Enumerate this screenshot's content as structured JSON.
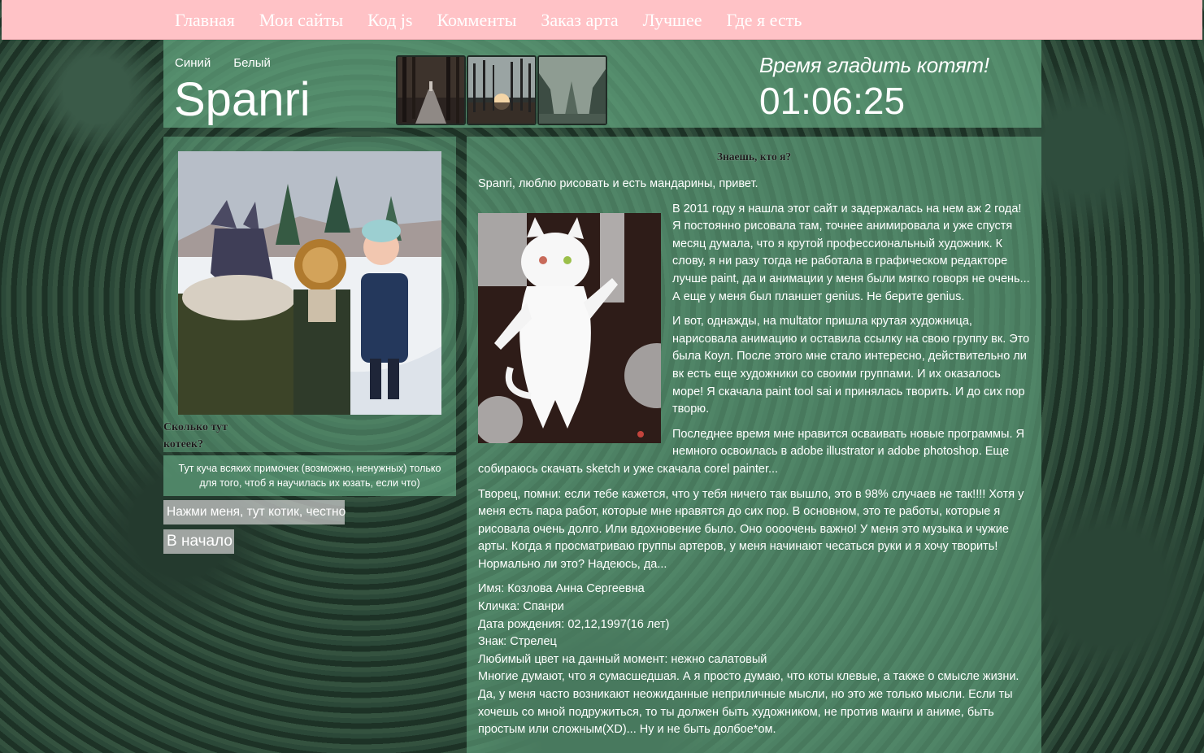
{
  "nav": {
    "items": [
      "Главная",
      "Мои сайты",
      "Код js",
      "Комменты",
      "Заказ арта",
      "Лучшее",
      "Где я есть"
    ]
  },
  "header": {
    "theme_blue": "Синий",
    "theme_white": "Белый",
    "site_name": "Spanri",
    "tagline": "Время гладить котят!",
    "clock": "01:06:25",
    "thumbnails": [
      "forest-road-thumbnail",
      "forest-sunset-thumbnail",
      "forest-mist-thumbnail"
    ]
  },
  "sidebar": {
    "photo_caption": "Сколько тут котеек?",
    "note": "Тут куча всяких примочек (возможно, ненужных) только для того, чтоб я научилась их юзать, если что)",
    "cat_button": "Нажми меня, тут котик, честно",
    "top_button": "В начало"
  },
  "main": {
    "title": "Знаешь, кто я?",
    "intro": "Spanri, люблю рисовать и есть мандарины, привет.",
    "p1": "В 2011 году я нашла этот сайт и задержалась на нем аж 2 года! Я постоянно рисовала там, точнее анимировала и уже спустя месяц думала, что я крутой профессиональный художник. К слову, я ни разу тогда не работала в графическом редакторе лучше paint, да и анимации у меня были мягко говоря не очень... А еще у меня был планшет genius. Не берите genius.",
    "p2": "И вот, однажды, на multator пришла крутая художница, нарисовала анимацию и оставила ссылку на свою группу вк. Это была Коул. После этого мне стало интересно, действительно ли вк есть еще художники со своими группами. И их оказалось море! Я скачала paint tool sai и принялась творить. И до сих пор творю.",
    "p3": "Последнее время мне нравится осваивать новые программы. Я немного освоилась в adobe illustrator и adobe photoshop. Еще собираюсь скачать sketch и уже скачала corel painter...",
    "p4": "Творец, помни: если тебе кажется, что у тебя ничего так вышло, это в 98% случаев не так!!!! Хотя у меня есть пара работ, которые мне нравятся до сих пор. В основном, это те работы, которые я рисовала очень долго. Или вдохновение было. Оно оооочень важно! У меня это музыка и чужие арты. Когда я просматриваю группы артеров, у меня начинают чесаться руки и я хочу творить! Нормально ли это? Надеюсь, да...",
    "profile": {
      "name": "Имя: Козлова Анна Сергеевна",
      "nickname": "Кличка: Спанри",
      "birthday": "Дата рождения: 02,12,1997(16 лет)",
      "sign": "Знак: Стрелец",
      "color": "Любимый цвет на данный момент: нежно салатовый",
      "about": "Многие думают, что я сумасшедшая. А я просто думаю, что коты клевые, а также о смысле жизни. Да, у меня часто возникают неожиданные неприличные мысли, но это же только мысли. Если ты хочешь со мной подружиться, то ты должен быть художником, не против манги и аниме, быть простым или сложным(XD)... Ну и не быть долбое*ом."
    }
  },
  "colors": {
    "nav_bg": "#ffc2c6",
    "panel_green": "#62a580",
    "text_white": "#ffffff"
  }
}
